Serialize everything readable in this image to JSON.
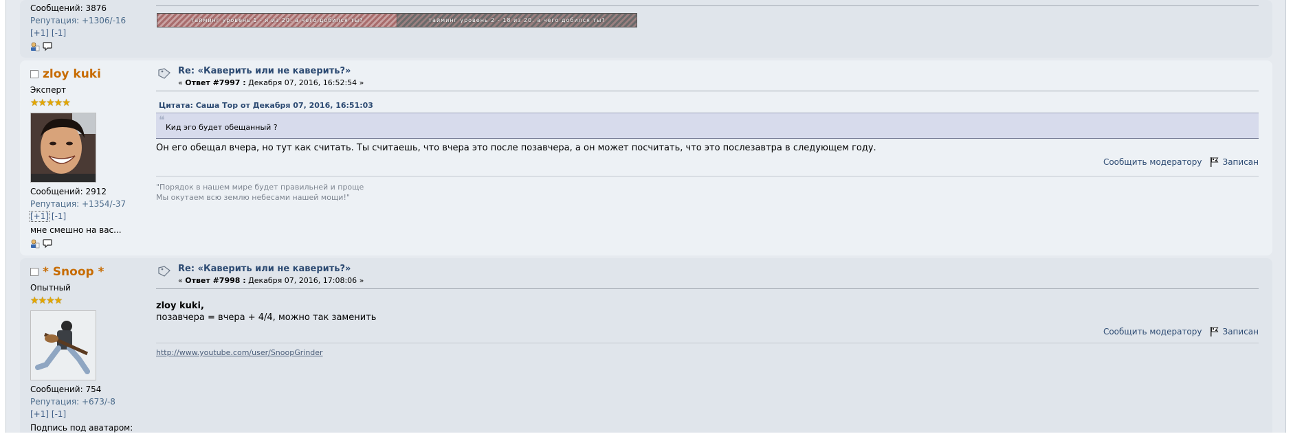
{
  "post0": {
    "messages": "Сообщений: 3876",
    "reputation": "Репутация: +1306/-16",
    "plus": "[+1]",
    "minus": "[-1]",
    "banner1": "тайминг уровень 1 - я из 20. а чего добился ты?",
    "banner2": "тайминг уровень 2 - 18 из 20. а чего добился ты?"
  },
  "post1": {
    "name": "zloy kuki",
    "group": "Эксперт",
    "stars": "★★★★★",
    "messages": "Сообщений: 2912",
    "reputation": "Репутация: +1354/-37",
    "plus": "[+1]",
    "minus": "[-1]",
    "personal_text": "мне смешно на вас...",
    "subject": "Re: «Каверить или не каверить?»",
    "meta_prefix": "« ",
    "reply_label": "Ответ #7997 :",
    "meta_date": " Декабря 07, 2016, 16:52:54 »",
    "quote_header": "Цитата: Саша Тор от Декабря 07, 2016, 16:51:03",
    "quote_mark": "❝",
    "quote_text": "Кид эго будет обещанный ?",
    "body": "Он его обещал вчера, но тут как считать. Ты считаешь, что вчера это после позавчера, а он может посчитать, что это послезавтра в следующем году.",
    "report": "Сообщить модератору",
    "logged": "Записан",
    "sig_line1": "\"Порядок в нашем мире будет правильней и проще",
    "sig_line2": "Мы окутаем всю землю небесами нашей мощи!\""
  },
  "post2": {
    "name": "* Snoop *",
    "group": "Опытный",
    "stars": "★★★★",
    "messages": "Сообщений: 754",
    "reputation": "Репутация: +673/-8",
    "plus": "[+1]",
    "minus": "[-1]",
    "personal_text": "Подпись под аватаром:",
    "subject": "Re: «Каверить или не каверить?»",
    "meta_prefix": "« ",
    "reply_label": "Ответ #7998 :",
    "meta_date": " Декабря 07, 2016, 17:08:06 »",
    "body_bold": "zloy kuki,",
    "body": "позавчера = вчера + 4/4, можно так заменить",
    "report": "Сообщить модератору",
    "logged": "Записан",
    "sig_link": "http://www.youtube.com/user/SnoopGrinder"
  },
  "colors": {
    "name": "#c76b00",
    "link": "#2c4a72",
    "quote_bg": "#d7dbec"
  },
  "icons": [
    "checkbox-icon",
    "topic-icon",
    "profile-icon",
    "pm-icon",
    "report-flag-icon"
  ]
}
